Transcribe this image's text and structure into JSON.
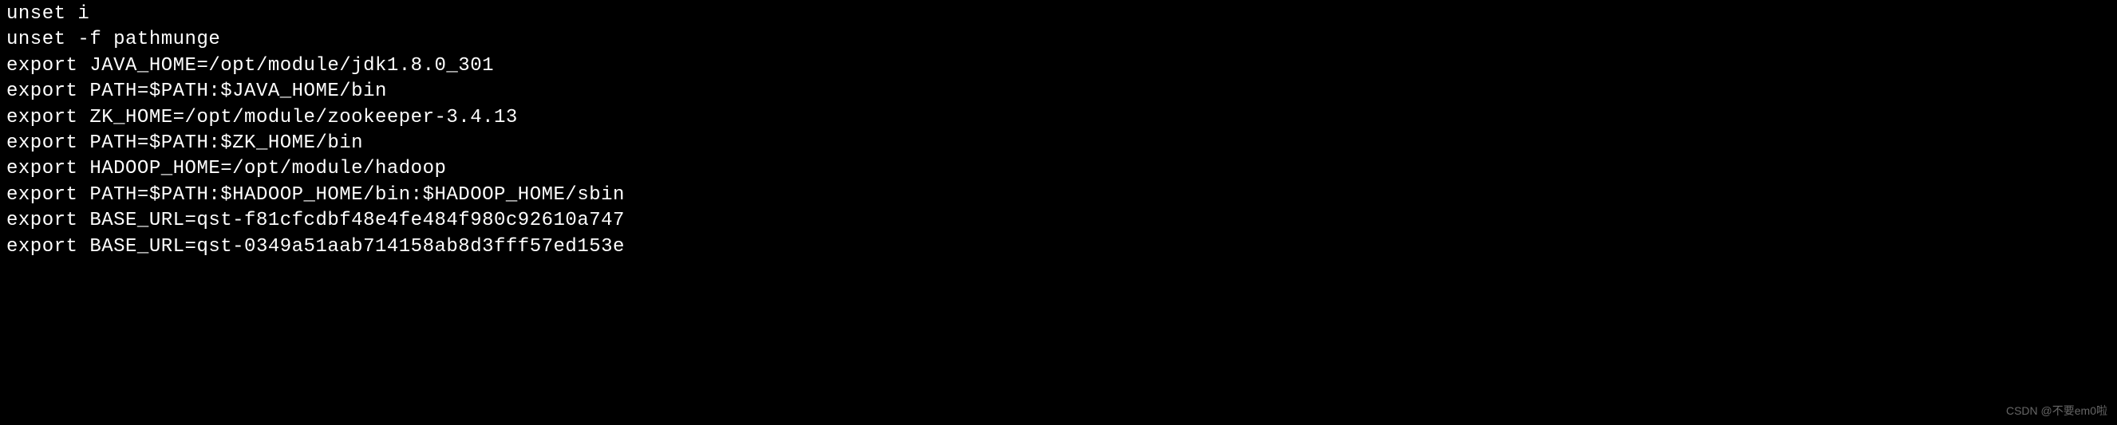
{
  "terminal": {
    "lines": [
      "unset i",
      "unset -f pathmunge",
      "export JAVA_HOME=/opt/module/jdk1.8.0_301",
      "export PATH=$PATH:$JAVA_HOME/bin",
      "export ZK_HOME=/opt/module/zookeeper-3.4.13",
      "export PATH=$PATH:$ZK_HOME/bin",
      "export HADOOP_HOME=/opt/module/hadoop",
      "export PATH=$PATH:$HADOOP_HOME/bin:$HADOOP_HOME/sbin",
      "export BASE_URL=qst-f81cfcdbf48e4fe484f980c92610a747",
      "export BASE_URL=qst-0349a51aab714158ab8d3fff57ed153e"
    ]
  },
  "watermark": "CSDN @不要em0啦"
}
